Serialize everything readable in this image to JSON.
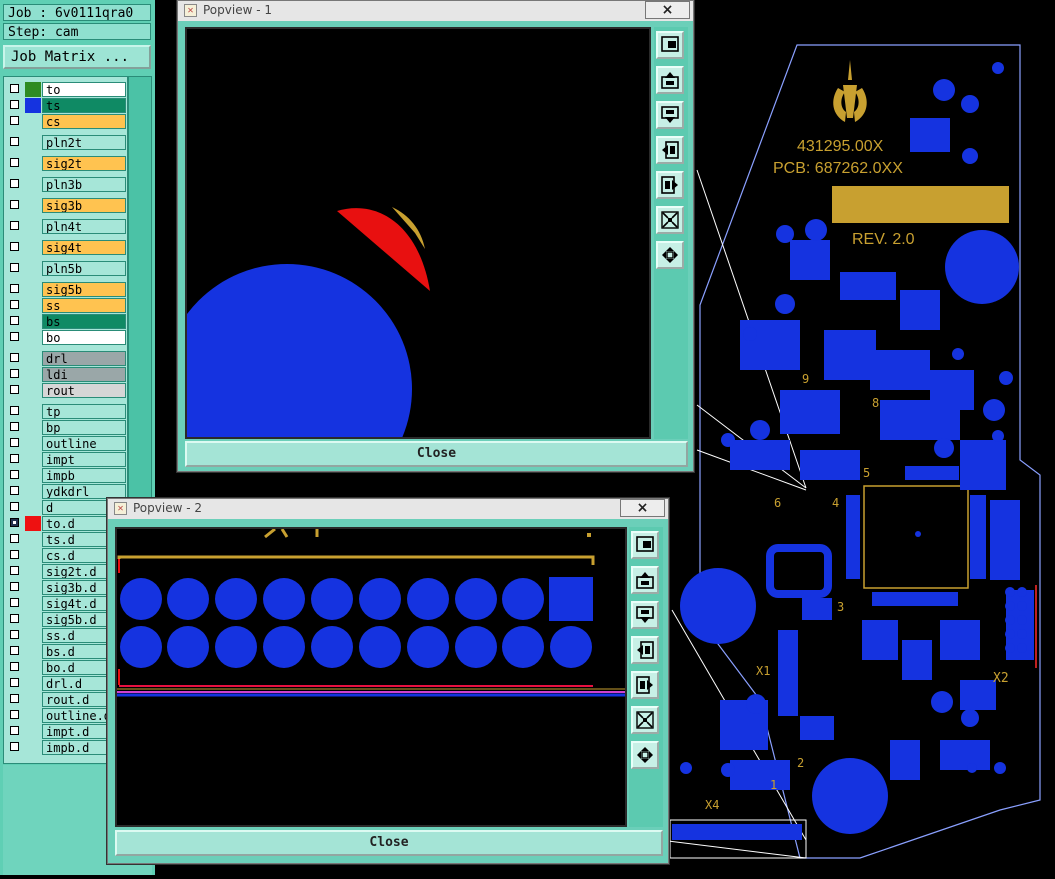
{
  "job_info": {
    "job": "Job : 6v0111qra0",
    "step": "Step: cam"
  },
  "job_matrix_button": "Job Matrix ...",
  "layers": [
    {
      "name": "to",
      "color": "#ffffff",
      "swatch": "#2e8b22",
      "checked": false
    },
    {
      "name": "ts",
      "color": "#0f8a64",
      "swatch": "#1533e0",
      "checked": false
    },
    {
      "name": "cs",
      "color": "#ffc350",
      "swatch": "",
      "checked": false
    },
    {
      "name": "pln2t",
      "color": "#a6e6d8",
      "swatch": "",
      "checked": false
    },
    {
      "name": "sig2t",
      "color": "#ffc350",
      "swatch": "",
      "checked": false
    },
    {
      "name": "pln3b",
      "color": "#a6e6d8",
      "swatch": "",
      "checked": false
    },
    {
      "name": "sig3b",
      "color": "#ffc350",
      "swatch": "",
      "checked": false
    },
    {
      "name": "pln4t",
      "color": "#a6e6d8",
      "swatch": "",
      "checked": false
    },
    {
      "name": "sig4t",
      "color": "#ffc350",
      "swatch": "",
      "checked": false
    },
    {
      "name": "pln5b",
      "color": "#a6e6d8",
      "swatch": "",
      "checked": false
    },
    {
      "name": "sig5b",
      "color": "#ffc350",
      "swatch": "",
      "checked": false
    },
    {
      "name": "ss",
      "color": "#ffc350",
      "swatch": "",
      "checked": false
    },
    {
      "name": "bs",
      "color": "#0f8a64",
      "swatch": "",
      "checked": false
    },
    {
      "name": "bo",
      "color": "#ffffff",
      "swatch": "",
      "checked": false
    },
    {
      "name": "drl",
      "color": "#9aa7a8",
      "swatch": "",
      "checked": false
    },
    {
      "name": "ldi",
      "color": "#9aa7a8",
      "swatch": "",
      "checked": false
    },
    {
      "name": "rout",
      "color": "#d6d6d6",
      "swatch": "",
      "checked": false
    },
    {
      "name": "tp",
      "color": "#a6e6d8",
      "swatch": "",
      "checked": false
    },
    {
      "name": "bp",
      "color": "#a6e6d8",
      "swatch": "",
      "checked": false
    },
    {
      "name": "outline",
      "color": "#a6e6d8",
      "swatch": "",
      "checked": false
    },
    {
      "name": "impt",
      "color": "#a6e6d8",
      "swatch": "",
      "checked": false
    },
    {
      "name": "impb",
      "color": "#a6e6d8",
      "swatch": "",
      "checked": false
    },
    {
      "name": "ydkdrl",
      "color": "#a6e6d8",
      "swatch": "",
      "checked": false
    },
    {
      "name": "d",
      "color": "#a6e6d8",
      "swatch": "",
      "checked": false
    },
    {
      "name": "to.d",
      "color": "#a6e6d8",
      "swatch": "#ee1111",
      "checked": true
    },
    {
      "name": "ts.d",
      "color": "#a6e6d8",
      "swatch": "",
      "checked": false
    },
    {
      "name": "cs.d",
      "color": "#a6e6d8",
      "swatch": "",
      "checked": false
    },
    {
      "name": "sig2t.d",
      "color": "#a6e6d8",
      "swatch": "",
      "checked": false
    },
    {
      "name": "sig3b.d",
      "color": "#a6e6d8",
      "swatch": "",
      "checked": false
    },
    {
      "name": "sig4t.d",
      "color": "#a6e6d8",
      "swatch": "",
      "checked": false
    },
    {
      "name": "sig5b.d",
      "color": "#a6e6d8",
      "swatch": "",
      "checked": false
    },
    {
      "name": "ss.d",
      "color": "#a6e6d8",
      "swatch": "",
      "checked": false
    },
    {
      "name": "bs.d",
      "color": "#a6e6d8",
      "swatch": "",
      "checked": false
    },
    {
      "name": "bo.d",
      "color": "#a6e6d8",
      "swatch": "",
      "checked": false
    },
    {
      "name": "drl.d",
      "color": "#a6e6d8",
      "swatch": "",
      "checked": false
    },
    {
      "name": "rout.d",
      "color": "#a6e6d8",
      "swatch": "",
      "checked": false
    },
    {
      "name": "outline.d",
      "color": "#a6e6d8",
      "swatch": "",
      "checked": false
    },
    {
      "name": "impt.d",
      "color": "#a6e6d8",
      "swatch": "",
      "checked": false
    },
    {
      "name": "impb.d",
      "color": "#a6e6d8",
      "swatch": "",
      "checked": false
    }
  ],
  "popview1": {
    "title": "Popview - 1",
    "close_x": "×",
    "close_label": "Close"
  },
  "popview2": {
    "title": "Popview - 2",
    "close_x": "×",
    "close_label": "Close"
  },
  "toolbar_icons": [
    "zoom-home-icon",
    "pan-up-icon",
    "pan-down-icon",
    "pan-left-icon",
    "pan-right-icon",
    "zoom-in-icon",
    "zoom-out-icon"
  ],
  "pcb": {
    "part_number": "431295.00X",
    "pcb_number": "PCB: 687262.0XX",
    "revision": "REV. 2.0",
    "ref_x1": "X1",
    "ref_x2": "X2",
    "ref_x4": "X4",
    "marks": [
      "9",
      "8",
      "5",
      "6",
      "4",
      "3",
      "2",
      "1"
    ],
    "silkscreen_color": "#c8a030",
    "copper_color": "#1533e0"
  }
}
